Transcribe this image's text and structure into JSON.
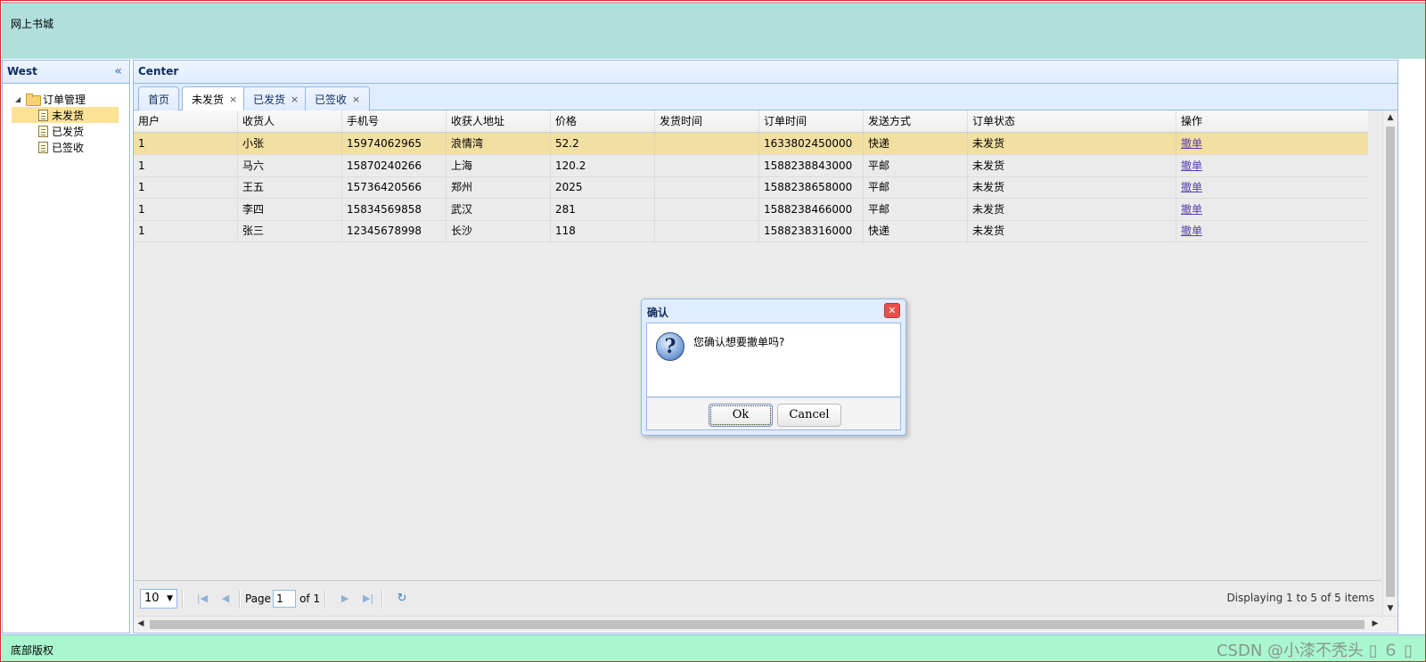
{
  "north": {
    "title": "网上书城"
  },
  "west": {
    "title": "West",
    "tree": {
      "root": "订单管理",
      "children": [
        "未发货",
        "已发货",
        "已签收"
      ]
    }
  },
  "center": {
    "title": "Center",
    "tabs": [
      {
        "label": "首页",
        "closable": false
      },
      {
        "label": "未发货",
        "closable": true
      },
      {
        "label": "已发货",
        "closable": true
      },
      {
        "label": "已签收",
        "closable": true
      }
    ],
    "columns": [
      "用户",
      "收货人",
      "手机号",
      "收获人地址",
      "价格",
      "发货时间",
      "订单时间",
      "发送方式",
      "订单状态",
      "操作"
    ],
    "rows": [
      [
        "1",
        "小张",
        "15974062965",
        "浪情湾",
        "52.2",
        "",
        "1633802450000",
        "快递",
        "未发货",
        "撤单"
      ],
      [
        "1",
        "马六",
        "15870240266",
        "上海",
        "120.2",
        "",
        "1588238843000",
        "平邮",
        "未发货",
        "撤单"
      ],
      [
        "1",
        "王五",
        "15736420566",
        "郑州",
        "2025",
        "",
        "1588238658000",
        "平邮",
        "未发货",
        "撤单"
      ],
      [
        "1",
        "李四",
        "15834569858",
        "武汉",
        "281",
        "",
        "1588238466000",
        "平邮",
        "未发货",
        "撤单"
      ],
      [
        "1",
        "张三",
        "12345678998",
        "长沙",
        "118",
        "",
        "1588238316000",
        "快递",
        "未发货",
        "撤单"
      ]
    ],
    "pager": {
      "page_size": "10",
      "page_label": "Page",
      "page_value": "1",
      "of_label": "of 1",
      "info": "Displaying 1 to 5 of 5 items"
    }
  },
  "south": {
    "text": "底部版权"
  },
  "watermark": "CSDN @小漆不秃头 ▯ ６ ▯",
  "dialog": {
    "title": "确认",
    "message": "您确认想要撤单吗?",
    "ok_label": "Ok",
    "cancel_label": "Cancel"
  },
  "colors": {
    "north_bg": "#b1dfdb",
    "south_bg": "#aaf6cf",
    "selected_row": "#f2dfa2",
    "border": "#95b8e7"
  }
}
